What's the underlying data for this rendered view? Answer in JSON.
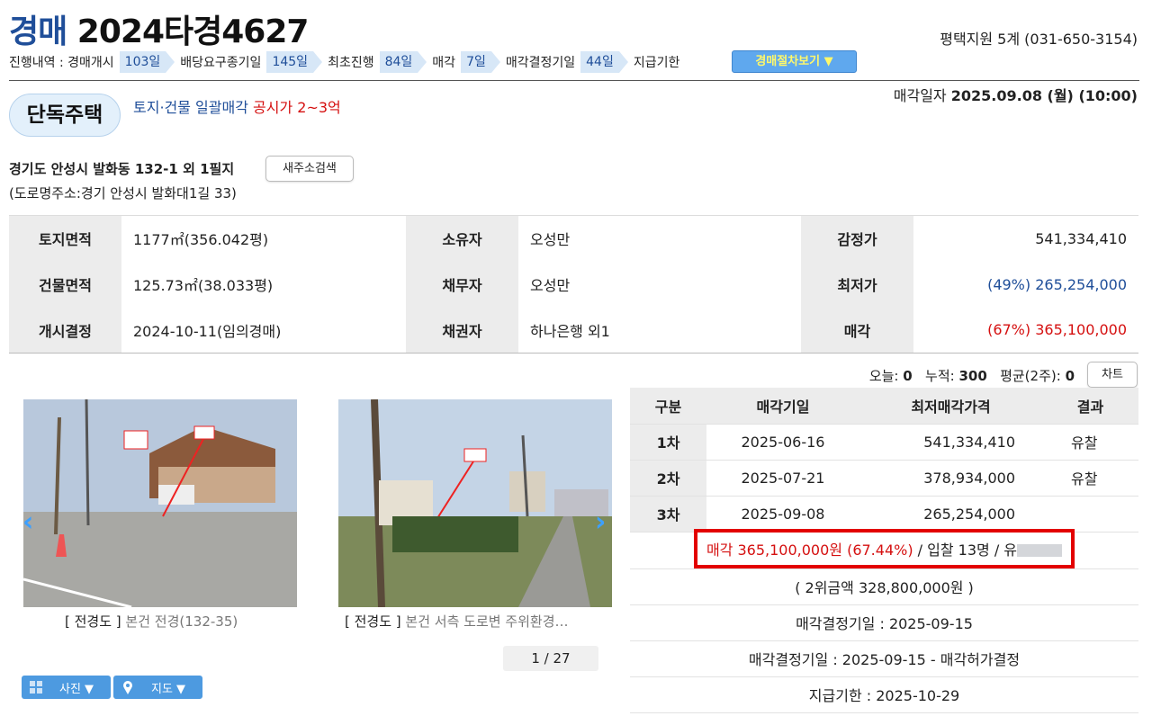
{
  "header": {
    "title_kw": "경매",
    "title_no": "2024타경4627",
    "court": "평택지원 5계 (031-650-3154)"
  },
  "progress": {
    "prefix": "진행내역 :",
    "steps": [
      {
        "label": "경매개시",
        "days": "103일"
      },
      {
        "label": "배당요구종기일",
        "days": "145일"
      },
      {
        "label": "최초진행",
        "days": "84일"
      },
      {
        "label": "매각",
        "days": "7일"
      },
      {
        "label": "매각결정기일",
        "days": "44일"
      },
      {
        "label": "지급기한",
        "days": ""
      }
    ],
    "proc_button": "경매절차보기 ▼"
  },
  "property": {
    "type": "단독주택",
    "desc_blue": "토지·건물 일괄매각",
    "desc_red": "공시가 2~3억",
    "auction_date_label": "매각일자",
    "auction_date": "2025.09.08 (월) (10:00)",
    "address": "경기도 안성시 발화동 132-1 외 1필지",
    "address_button": "새주소검색",
    "road_address": "(도로명주소:경기 안성시 발화대1길 33)"
  },
  "info": {
    "rows": [
      {
        "h1": "토지면적",
        "v1": "1177㎡(356.042평)",
        "h2": "소유자",
        "v2": "오성만",
        "h3": "감정가",
        "v3": "541,334,410"
      },
      {
        "h1": "건물면적",
        "v1": "125.73㎡(38.033평)",
        "h2": "채무자",
        "v2": "오성만",
        "h3": "최저가",
        "v3": "(49%) 265,254,000"
      },
      {
        "h1": "개시결정",
        "v1": "2024-10-11(임의경매)",
        "h2": "채권자",
        "v2": "하나은행 외1",
        "h3": "매각",
        "v3": "(67%) 365,100,000"
      }
    ]
  },
  "stats": {
    "today_label": "오늘:",
    "today": "0",
    "total_label": "누적:",
    "total": "300",
    "avg_label": "평균(2주):",
    "avg": "0",
    "chart_button": "차트"
  },
  "photos": {
    "items": [
      {
        "tag": "[ 전경도 ]",
        "sub": "본건 전경(132-35)"
      },
      {
        "tag": "[ 전경도 ]",
        "sub": "본건 서측 도로변 주위환경…"
      }
    ],
    "pager": "1 / 27",
    "photo_button": "사진 ▼",
    "map_button": "지도 ▼"
  },
  "history": {
    "headers": [
      "구분",
      "매각기일",
      "최저매각가격",
      "결과"
    ],
    "rows": [
      {
        "round": "1차",
        "date": "2025-06-16",
        "price": "541,334,410",
        "result": "유찰"
      },
      {
        "round": "2차",
        "date": "2025-07-21",
        "price": "378,934,000",
        "result": "유찰"
      },
      {
        "round": "3차",
        "date": "2025-09-08",
        "price": "265,254,000",
        "result": ""
      }
    ],
    "sale_result": "매각 365,100,000원 (67.44%)",
    "bidders": " / 입찰 13명 / 유",
    "second_bid": "( 2위금액 328,800,000원 )",
    "decision_date": "매각결정기일 : 2025-09-15",
    "decision_result": "매각결정기일 : 2025-09-15 - 매각허가결정",
    "payment_deadline": "지급기한 : 2025-10-29"
  },
  "colors": {
    "brand_blue": "#1f4e99",
    "alert_red": "#d51010",
    "step_bg": "#d7e7f7",
    "button_blue": "#5fa8ee"
  }
}
